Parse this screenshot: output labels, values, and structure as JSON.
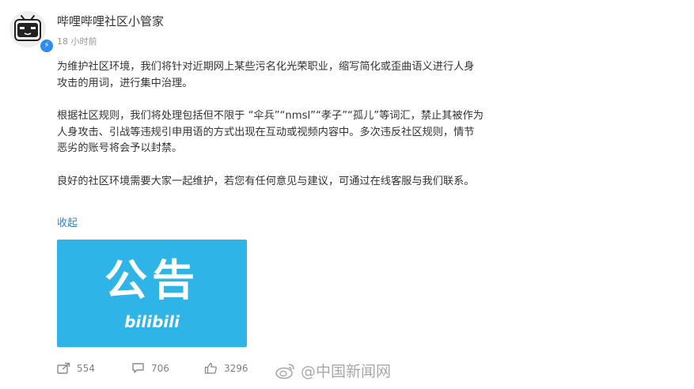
{
  "post": {
    "username": "哔哩哔哩社区小管家",
    "timestamp": "18 小时前",
    "paragraphs": [
      "为维护社区环境，我们将针对近期网上某些污名化光荣职业，缩写简化或歪曲语义进行人身攻击的用词，进行集中治理。",
      "根据社区规则，我们将处理包括但不限于 “伞兵”“nmsl”“孝子”“孤儿”等词汇，禁止其被作为人身攻击、引战等违规引申用语的方式出现在互动或视频内容中。多次违反社区规则，情节恶劣的账号将会予以封禁。",
      "良好的社区环境需要大家一起维护，若您有任何意见与建议，可通过在线客服与我们联系。"
    ],
    "collapse_label": "收起",
    "image": {
      "title": "公告",
      "logo_text": "bilibili",
      "color": "#2fb4e8"
    }
  },
  "actions": {
    "share": {
      "icon": "share-icon",
      "count": "554"
    },
    "comment": {
      "icon": "comment-icon",
      "count": "706"
    },
    "like": {
      "icon": "thumbs-up-icon",
      "count": "3296"
    }
  },
  "watermark": {
    "icon": "weibo-icon",
    "text": "@中国新闻网"
  },
  "colors": {
    "link": "#3b7fc4",
    "verified_badge": "#2d8cf0"
  }
}
